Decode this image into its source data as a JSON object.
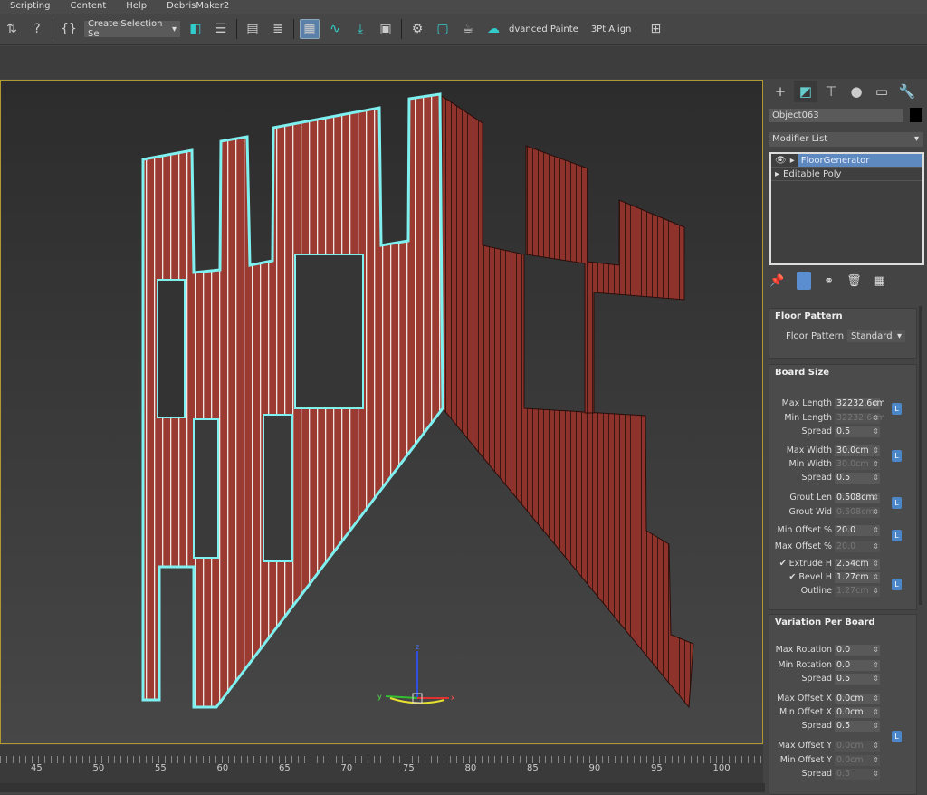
{
  "menu": [
    "Scripting",
    "Content",
    "Help",
    "DebrisMaker2"
  ],
  "toolbar": {
    "selection_set": "Create Selection Se",
    "advanced_paint": "dvanced Painte",
    "align_3pt": "3Pt Align"
  },
  "timeline": {
    "ticks": [
      "45",
      "50",
      "55",
      "60",
      "65",
      "70",
      "75",
      "80",
      "85",
      "90",
      "95",
      "100"
    ]
  },
  "panel": {
    "object_name": "Object063",
    "object_color": "#000000",
    "modifier_list": "Modifier List",
    "stack": [
      "FloorGenerator",
      "Editable Poly"
    ],
    "floor_pattern": {
      "title": "Floor Pattern",
      "label": "Floor Pattern",
      "value": "Standard"
    },
    "board_size": {
      "title": "Board Size",
      "rows": [
        {
          "label": "Max Length",
          "value": "32232.6cm",
          "enabled": true
        },
        {
          "label": "Min Length",
          "value": "32232.6cm",
          "enabled": false
        },
        {
          "label": "Spread",
          "value": "0.5",
          "enabled": true
        },
        {
          "label": "Max Width",
          "value": "30.0cm",
          "enabled": true
        },
        {
          "label": "Min Width",
          "value": "30.0cm",
          "enabled": false
        },
        {
          "label": "Spread",
          "value": "0.5",
          "enabled": true
        },
        {
          "label": "Grout Len",
          "value": "0.508cm",
          "enabled": true
        },
        {
          "label": "Grout Wid",
          "value": "0.508cm",
          "enabled": false
        },
        {
          "label": "Min Offset %",
          "value": "20.0",
          "enabled": true
        },
        {
          "label": "Max Offset %",
          "value": "20.0",
          "enabled": false
        },
        {
          "label": "✔ Extrude  H",
          "value": "2.54cm",
          "enabled": true
        },
        {
          "label": "✔ Bevel    H",
          "value": "1.27cm",
          "enabled": true
        },
        {
          "label": "Outline",
          "value": "1.27cm",
          "enabled": false
        }
      ]
    },
    "variation": {
      "title": "Variation Per Board",
      "rows": [
        {
          "label": "Max Rotation",
          "value": "0.0",
          "enabled": true
        },
        {
          "label": "Min Rotation",
          "value": "0.0",
          "enabled": true
        },
        {
          "label": "Spread",
          "value": "0.5",
          "enabled": true
        },
        {
          "label": "Max Offset X",
          "value": "0.0cm",
          "enabled": true
        },
        {
          "label": "Min Offset X",
          "value": "0.0cm",
          "enabled": true
        },
        {
          "label": "Spread",
          "value": "0.5",
          "enabled": true
        },
        {
          "label": "Max Offset Y",
          "value": "0.0cm",
          "enabled": false
        },
        {
          "label": "Min Offset Y",
          "value": "0.0cm",
          "enabled": false
        },
        {
          "label": "Spread",
          "value": "0.5",
          "enabled": false
        }
      ]
    },
    "lock_label": "L"
  },
  "gizmo": {
    "x": "x",
    "y": "y",
    "z": "z"
  },
  "colors": {
    "wood": "#9a3a30",
    "selection": "#7ff0f0",
    "viewport_border": "#b09a30",
    "accent": "#5e88c0"
  }
}
